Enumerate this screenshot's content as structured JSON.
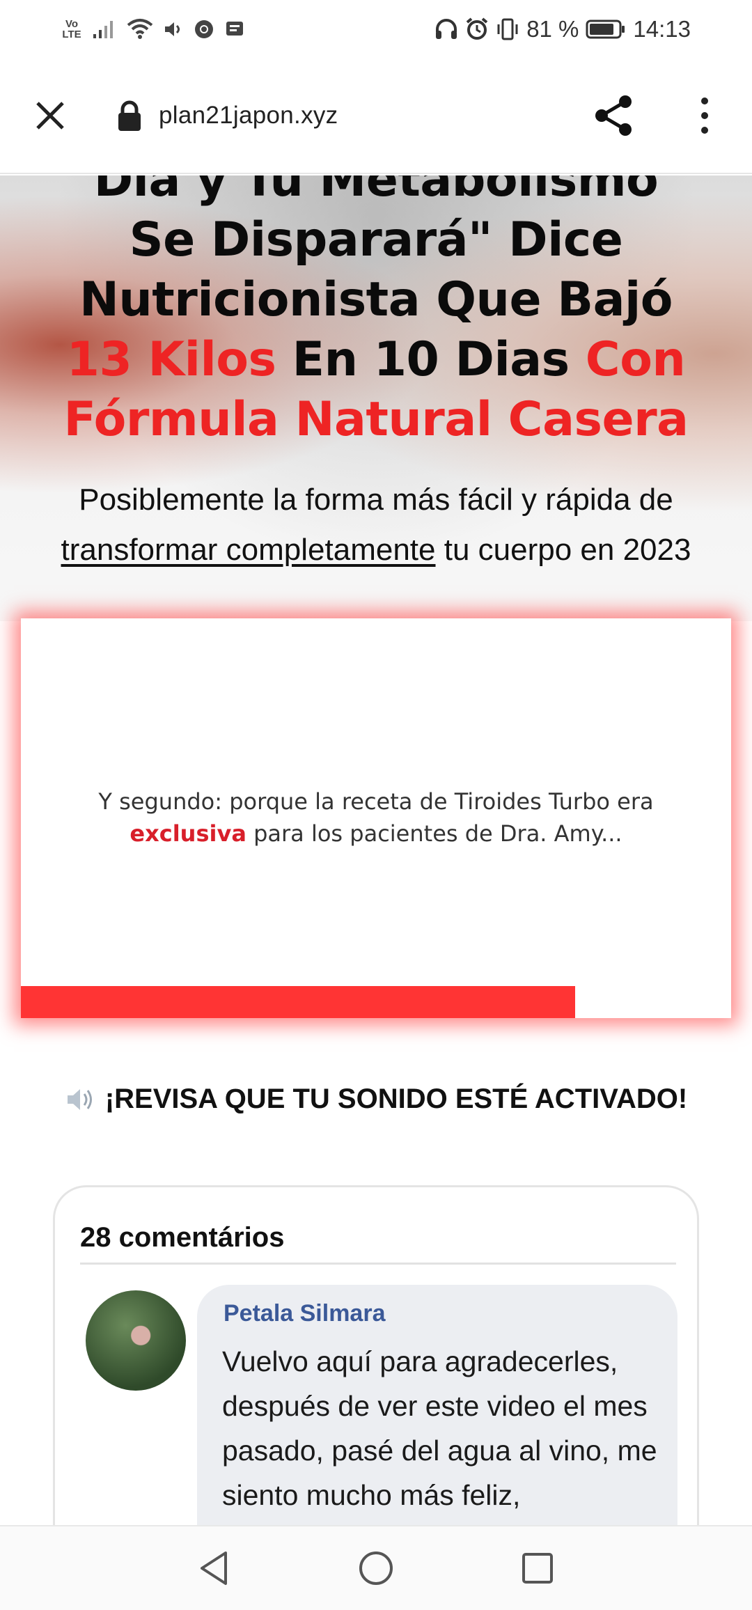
{
  "status_bar": {
    "network": "Vo LTE",
    "battery_percent": "81 %",
    "time": "14:13",
    "icons": [
      "volte-icon",
      "signal-icon",
      "wifi-icon",
      "volume-icon",
      "chrome-icon",
      "message-icon",
      "headphones-icon",
      "alarm-icon",
      "vibrate-icon",
      "battery-icon"
    ]
  },
  "browser": {
    "url": "plan21japon.xyz",
    "icons": [
      "close-icon",
      "lock-icon",
      "share-icon",
      "more-icon"
    ]
  },
  "hero": {
    "title_line1": "Dia y Tu Metabolismo",
    "title_line2": "Se Disparará\" Dice",
    "title_line3": "Nutricionista Que Bajó",
    "title_line4_red1": "13 Kilos",
    "title_line4_black": " En 10 Dias ",
    "title_line4_red2": "Con",
    "title_line5": "Fórmula Natural Casera",
    "subtitle_line1": "Posiblemente la forma más fácil y rápida de",
    "subtitle_underlined": "transformar completamente",
    "subtitle_line2_rest": " tu cuerpo en 2023"
  },
  "video": {
    "caption_line1": "Y segundo: porque la receta de Tiroides Turbo era",
    "caption_red": "exclusiva",
    "caption_line2_rest": " para los pacientes de Dra. Amy...",
    "progress_fraction": 0.78,
    "accent_color": "#ff3434"
  },
  "sound_notice": {
    "icon": "speaker-icon",
    "text": "¡REVISA QUE TU SONIDO ESTÉ ACTIVADO!"
  },
  "comments": {
    "title": "28 comentários",
    "items": [
      {
        "author": "Petala Silmara",
        "text": "Vuelvo aquí para agradecerles, después de ver este video el mes pasado, pasé del agua al vino, me siento mucho más feliz,"
      }
    ],
    "author_color": "#3b5998"
  },
  "nav_bar": {
    "icons": [
      "back-icon",
      "home-icon",
      "recents-icon"
    ]
  }
}
